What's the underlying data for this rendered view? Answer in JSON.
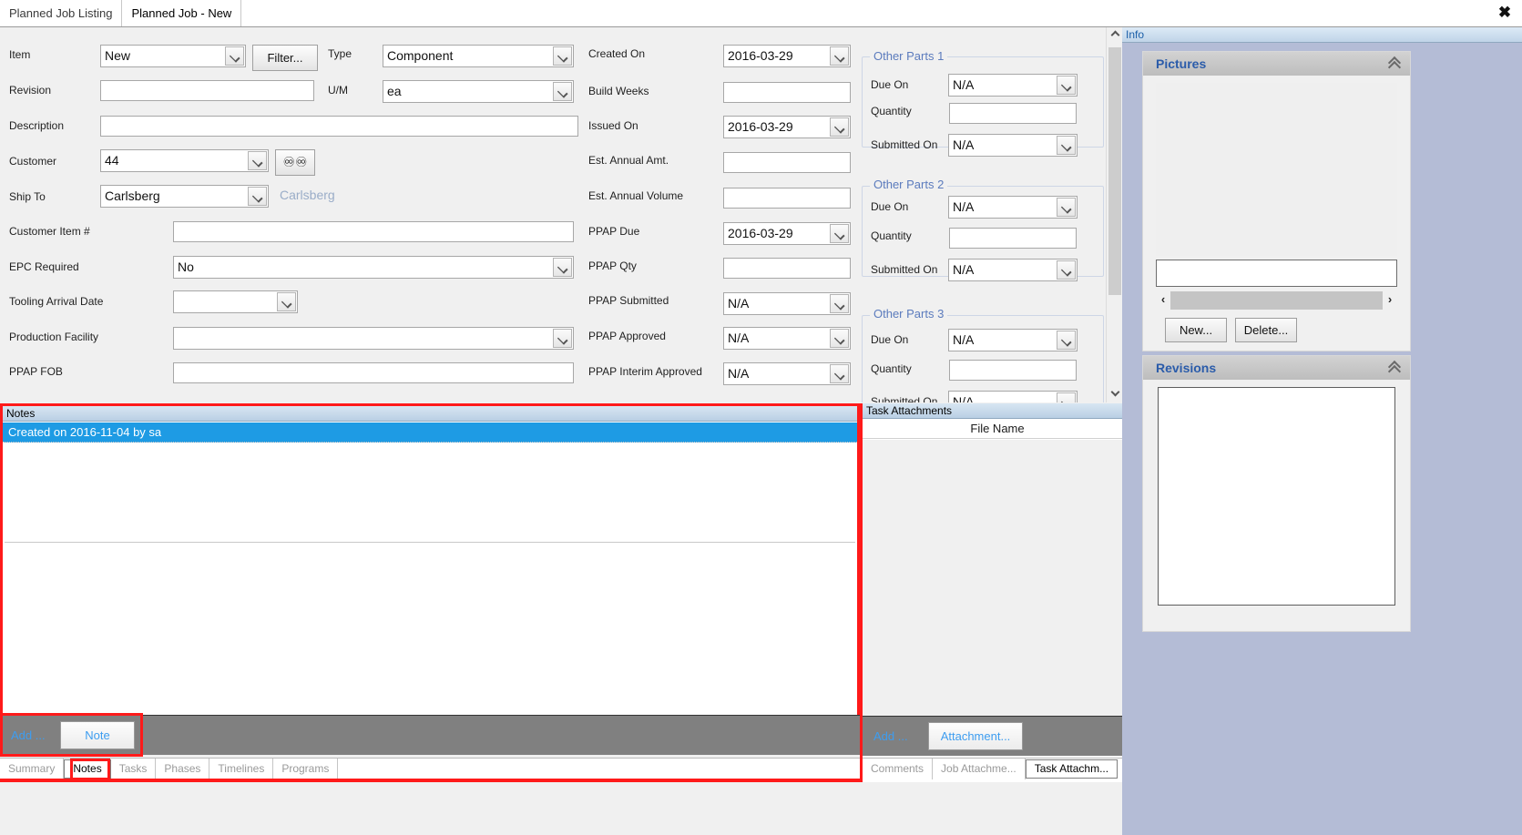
{
  "window": {
    "close_label": "✖"
  },
  "top_tabs": [
    {
      "label": "Planned Job Listing",
      "active": false
    },
    {
      "label": "Planned Job - New",
      "active": true
    }
  ],
  "form": {
    "col1": [
      {
        "label": "Item",
        "control": "combo",
        "value": "New"
      },
      {
        "label": "Revision",
        "control": "text",
        "value": ""
      },
      {
        "label": "Description",
        "control": "text",
        "value": ""
      },
      {
        "label": "Customer",
        "control": "combo",
        "value": "44"
      },
      {
        "label": "Ship To",
        "control": "combo",
        "value": "Carlsberg"
      },
      {
        "label": "Customer Item #",
        "control": "text",
        "value": ""
      },
      {
        "label": "EPC Required",
        "control": "combo",
        "value": "No"
      },
      {
        "label": "Tooling Arrival Date",
        "control": "combo",
        "value": ""
      },
      {
        "label": "Production Facility",
        "control": "combo",
        "value": ""
      },
      {
        "label": "PPAP FOB",
        "control": "text",
        "value": ""
      }
    ],
    "filter_button": "Filter...",
    "customer_lookup_icon": "binoculars-icon",
    "ship_to_static": "Carlsberg",
    "col2": [
      {
        "label": "Type",
        "control": "combo",
        "value": "Component"
      },
      {
        "label": "U/M",
        "control": "combo",
        "value": "ea"
      }
    ],
    "col3": [
      {
        "label": "Created On",
        "control": "combo",
        "value": "2016-03-29"
      },
      {
        "label": "Build Weeks",
        "control": "text",
        "value": ""
      },
      {
        "label": "Issued On",
        "control": "combo",
        "value": "2016-03-29"
      },
      {
        "label": "Est. Annual Amt.",
        "control": "text",
        "value": ""
      },
      {
        "label": "Est. Annual Volume",
        "control": "text",
        "value": ""
      },
      {
        "label": "PPAP Due",
        "control": "combo",
        "value": "2016-03-29"
      },
      {
        "label": "PPAP Qty",
        "control": "text",
        "value": ""
      },
      {
        "label": "PPAP Submitted",
        "control": "combo",
        "value": "N/A"
      },
      {
        "label": "PPAP Approved",
        "control": "combo",
        "value": "N/A"
      },
      {
        "label": "PPAP Interim Approved",
        "control": "combo",
        "value": "N/A"
      }
    ],
    "groups": [
      {
        "title": "Other Parts 1",
        "fields": [
          {
            "label": "Due On",
            "control": "combo",
            "value": "N/A"
          },
          {
            "label": "Quantity",
            "control": "text",
            "value": ""
          },
          {
            "label": "Submitted On",
            "control": "combo",
            "value": "N/A"
          }
        ]
      },
      {
        "title": "Other Parts 2",
        "fields": [
          {
            "label": "Due On",
            "control": "combo",
            "value": "N/A"
          },
          {
            "label": "Quantity",
            "control": "text",
            "value": ""
          },
          {
            "label": "Submitted On",
            "control": "combo",
            "value": "N/A"
          }
        ]
      },
      {
        "title": "Other Parts 3",
        "fields": [
          {
            "label": "Due On",
            "control": "combo",
            "value": "N/A"
          },
          {
            "label": "Quantity",
            "control": "text",
            "value": ""
          },
          {
            "label": "Submitted On",
            "control": "combo",
            "value": "N/A"
          }
        ]
      }
    ]
  },
  "notes_panel": {
    "caption": "Notes",
    "rows": [
      {
        "text": "Created on 2016-11-04 by sa",
        "selected": true
      }
    ],
    "toolbar": {
      "add_label": "Add ...",
      "note_button": "Note"
    },
    "tabs": [
      {
        "label": "Summary",
        "selected": false
      },
      {
        "label": "Notes",
        "selected": true
      },
      {
        "label": "Tasks",
        "selected": false
      },
      {
        "label": "Phases",
        "selected": false
      },
      {
        "label": "Timelines",
        "selected": false
      },
      {
        "label": "Programs",
        "selected": false
      }
    ]
  },
  "task_panel": {
    "caption": "Task Attachments",
    "column_header": "File Name",
    "toolbar": {
      "add_label": "Add ...",
      "attachment_button": "Attachment..."
    },
    "tabs": [
      {
        "label": "Comments",
        "selected": false
      },
      {
        "label": "Job Attachme...",
        "selected": false
      },
      {
        "label": "Task Attachm...",
        "selected": true
      }
    ]
  },
  "info_panel": {
    "caption": "Info",
    "pictures": {
      "title": "Pictures",
      "collapse_icon": "chevron-up-double-icon",
      "filename_value": "",
      "scroll_left_icon": "‹",
      "scroll_right_icon": "›",
      "new_button": "New...",
      "delete_button": "Delete..."
    },
    "revisions": {
      "title": "Revisions",
      "collapse_icon": "chevron-up-double-icon"
    }
  },
  "colors": {
    "highlight_red": "#ff1a1a",
    "selection_blue": "#1e9be4",
    "link_blue": "#3d9df0",
    "group_title_blue": "#5b7bbd",
    "card_title_blue": "#2b5caa"
  }
}
